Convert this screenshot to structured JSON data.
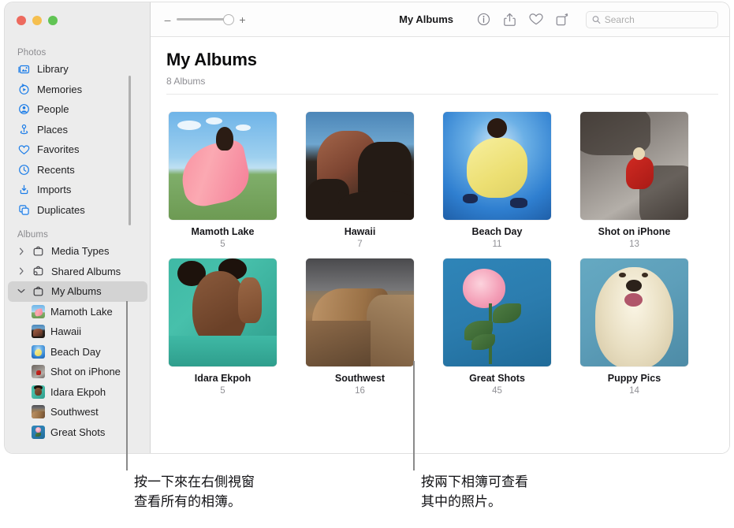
{
  "window": {
    "traffic_lights": [
      "close",
      "minimize",
      "zoom"
    ]
  },
  "toolbar": {
    "zoom_out_label": "–",
    "zoom_in_label": "+",
    "title": "My Albums",
    "buttons": [
      {
        "name": "info-button",
        "icon": "info-icon"
      },
      {
        "name": "share-button",
        "icon": "share-icon"
      },
      {
        "name": "favorite-button",
        "icon": "heart-icon"
      },
      {
        "name": "rotate-button",
        "icon": "rotate-icon"
      }
    ],
    "search": {
      "placeholder": "Search",
      "value": ""
    }
  },
  "sidebar": {
    "sections": [
      {
        "label": "Photos",
        "items": [
          {
            "label": "Library",
            "icon": "library-icon"
          },
          {
            "label": "Memories",
            "icon": "memories-icon"
          },
          {
            "label": "People",
            "icon": "people-icon"
          },
          {
            "label": "Places",
            "icon": "places-icon"
          },
          {
            "label": "Favorites",
            "icon": "heart-icon"
          },
          {
            "label": "Recents",
            "icon": "clock-icon"
          },
          {
            "label": "Imports",
            "icon": "import-icon"
          },
          {
            "label": "Duplicates",
            "icon": "duplicates-icon"
          }
        ]
      },
      {
        "label": "Albums",
        "items": [
          {
            "label": "Media Types",
            "icon": "album-icon",
            "chevron": "right"
          },
          {
            "label": "Shared Albums",
            "icon": "shared-album-icon",
            "chevron": "right"
          },
          {
            "label": "My Albums",
            "icon": "album-icon",
            "chevron": "down",
            "selected": true
          }
        ],
        "children": [
          {
            "label": "Mamoth Lake",
            "icon": "album-thumb-mamoth"
          },
          {
            "label": "Hawaii",
            "icon": "album-thumb-hawaii"
          },
          {
            "label": "Beach Day",
            "icon": "album-thumb-beach"
          },
          {
            "label": "Shot on iPhone",
            "icon": "album-thumb-iphone"
          },
          {
            "label": "Idara Ekpoh",
            "icon": "album-thumb-idara"
          },
          {
            "label": "Southwest",
            "icon": "album-thumb-southwest"
          },
          {
            "label": "Great Shots",
            "icon": "album-thumb-great"
          }
        ]
      }
    ]
  },
  "main": {
    "title": "My Albums",
    "subtitle": "8 Albums",
    "albums": [
      {
        "name": "Mamoth Lake",
        "count": "5",
        "art": "p-mamoth"
      },
      {
        "name": "Hawaii",
        "count": "7",
        "art": "p-hawaii"
      },
      {
        "name": "Beach Day",
        "count": "11",
        "art": "p-beach"
      },
      {
        "name": "Shot on iPhone",
        "count": "13",
        "art": "p-iphone"
      },
      {
        "name": "Idara Ekpoh",
        "count": "5",
        "art": "p-idara"
      },
      {
        "name": "Southwest",
        "count": "16",
        "art": "p-southwest"
      },
      {
        "name": "Great Shots",
        "count": "45",
        "art": "p-great"
      },
      {
        "name": "Puppy Pics",
        "count": "14",
        "art": "p-puppy"
      }
    ]
  },
  "callouts": [
    {
      "text": "按一下來在右側視窗\n查看所有的相簿。"
    },
    {
      "text": "按兩下相簿可查看\n其中的照片。"
    }
  ],
  "colors": {
    "accent": "#007aff",
    "sidebar_bg": "#ececec",
    "selection": "#d3d3d3",
    "callout_line": "#8a8a8a"
  }
}
